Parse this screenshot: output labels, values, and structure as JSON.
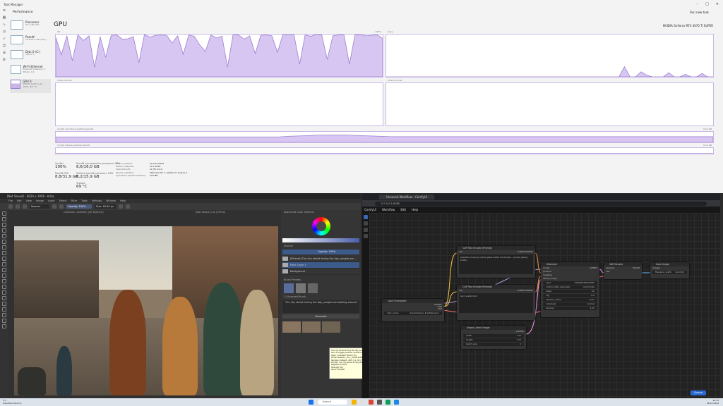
{
  "taskmanager": {
    "title": "Task Manager",
    "section": "Performance",
    "run_task": "Run new task",
    "sidebar": [
      {
        "name": "Processor",
        "sub": "4% 3.80 GHz"
      },
      {
        "name": "Paměť",
        "sub": "14,8/31,9 GB (46%)"
      },
      {
        "name": "Disk 0 (C:)",
        "sub": "SSD\n0 %"
      },
      {
        "name": "Wi-Fi Ethernet",
        "sub": "Ethernet\nOdesláno: 0 Přijato: 0 b"
      },
      {
        "name": "GPU 0",
        "sub": "NVIDIA GeForce R...\n100% (65 °C)"
      }
    ],
    "gpu_title": "GPU",
    "gpu_model": "NVIDIA GeForce RTX 4070 Ti SUPER",
    "panels": {
      "p3d": {
        "label": "3D",
        "right": "100%"
      },
      "copy": {
        "label": "Copy",
        "right": ""
      },
      "vdec": {
        "label": "Video Decode",
        "right": ""
      },
      "venc": {
        "label": "Video Encode",
        "right": ""
      },
      "dedicated": {
        "label": "Využití vyhrazené grafické paměti",
        "right": "16,0 GB"
      },
      "shared": {
        "label": "Využití sdílené grafické paměti",
        "right": "15,9 GB"
      }
    },
    "stats": {
      "util_label": "Využití",
      "util": "100%",
      "ded_label": "Paměť vyhrazeného procesoru GPU",
      "ded": "8,6/16,0 GB",
      "gpu_mem_label": "Paměť GPU",
      "gpu_mem": "8,8/31,9 GB",
      "shared_label": "Sdílená paměť procesoru GPU",
      "shared": "0,2/15,9 GB",
      "temp_label": "Teplota",
      "temp": "69 °C"
    },
    "details": {
      "labels": [
        "Verze ovladače:",
        "Datum ovladače:",
        "Verze DirectX:",
        "Fyzické umístění:",
        "Vyhrazená paměť hardwaru:"
      ],
      "values": [
        "32.0.15.6094",
        "10.7.2024",
        "12 (FL 12.1)",
        "Sběrnice PCI 1, zařízení 0, funkce 0",
        "123 MB"
      ]
    }
  },
  "krita": {
    "title": "[Not Saved]  - 4024 x 1956 - Krita",
    "menu": [
      "File",
      "Edit",
      "View",
      "Image",
      "Layer",
      "Select",
      "Filter",
      "Tools",
      "Settings",
      "Window",
      "Help"
    ],
    "preset": "Normal",
    "opacity": "Opacity: 100%",
    "size": "Size: 40.00 px",
    "tabs": [
      "Unknown (untitled) [2K 8-bit/ch]",
      "[Not Saved] 1.8 (1919x)"
    ],
    "docker_title": "Advanced Color Selector",
    "blend": "Normal",
    "opacity_row": "Opacity: 100%",
    "layers": [
      "[Filtered] The city street during the day, people are...",
      "Paint Layer 1",
      "Background"
    ],
    "brush_title": "Brush Presets",
    "brush_tag": "1) Unsaved Brush",
    "prompt_text": "The city street during the day, people are walking around",
    "generate": "Generate",
    "status_left": "Ahoj 1 Basic/Tangle",
    "status_mid": "RGB/Alpha (8-bit integer/channel)  sRGB-elle-V2-srgbtrc.icc",
    "status_right": "1,542.2 0.00 Mb",
    "zoom": "33.4%"
  },
  "tooltip": {
    "lines": [
      "The city street during the day, people are walking around",
      "Click to toggle preview, double-click to apply",
      "Style: Cinematic Photo (15)",
      "Model: Realistic_V5.1_noVAE.safetensors",
      "Sampler: Default - 60% 1.x (30 / 73)",
      "Prompt: The city street during the day, people are walking around",
      "Negative Prompt:",
      "Strength: 80",
      "Seed: 1234567"
    ]
  },
  "comfy": {
    "tab": "Unsaved Workflow - ComfyUI",
    "url": "127.0.0.1:8188",
    "menu": [
      "ComfyUI",
      "Workflow",
      "Edit",
      "Help"
    ],
    "queue": "Queue",
    "nodes": {
      "ckpt": {
        "title": "Load Checkpoint",
        "outs": [
          "MODEL",
          "CLIP",
          "VAE"
        ],
        "widget_label": "ckpt_name",
        "widget_value": "dreamshaper_8.safetensors"
      },
      "pos": {
        "title": "CLIP Text Encode (Prompt)",
        "out": "CONDITIONING",
        "in": "clip",
        "text": "beautiful scenery nature glass bottle landscape, , purple galaxy bottle,"
      },
      "neg": {
        "title": "CLIP Text Encode (Prompt)",
        "out": "CONDITIONING",
        "in": "clip",
        "text": "text, watermark"
      },
      "ks": {
        "title": "KSampler",
        "ins": [
          "model",
          "positive",
          "negative",
          "latent_image"
        ],
        "out": "LATENT",
        "widgets": [
          [
            "seed",
            "156680208700286"
          ],
          [
            "control_after_generate",
            "randomize"
          ],
          [
            "steps",
            "20"
          ],
          [
            "cfg",
            "8.0"
          ],
          [
            "sampler_name",
            "euler"
          ],
          [
            "scheduler",
            "normal"
          ],
          [
            "denoise",
            "1.00"
          ]
        ]
      },
      "latent": {
        "title": "Empty Latent Image",
        "out": "LATENT",
        "widgets": [
          [
            "width",
            "512"
          ],
          [
            "height",
            "512"
          ],
          [
            "batch_size",
            "1"
          ]
        ]
      },
      "vae": {
        "title": "VAE Decode",
        "ins": [
          "samples",
          "vae"
        ],
        "out": "IMAGE"
      },
      "save": {
        "title": "Save Image",
        "in": "images",
        "widget_label": "filename_prefix",
        "widget_value": "ComfyUI"
      }
    }
  },
  "taskbar": {
    "weather_temp": "5°C",
    "weather_text": "Převážně oblačno",
    "search": "Search",
    "time": "12:31",
    "date": "26.12.2024"
  },
  "chart_data": [
    {
      "type": "area",
      "title": "3D",
      "ylim": [
        0,
        100
      ],
      "values": [
        93,
        52,
        97,
        38,
        99,
        86,
        97,
        22,
        95,
        46,
        98,
        99,
        89,
        90,
        95,
        33,
        100,
        94,
        98,
        99,
        98,
        80,
        97,
        53,
        99,
        96,
        75,
        60,
        99,
        92,
        96,
        23,
        100,
        99,
        89,
        97,
        55,
        98,
        99,
        97,
        58,
        100,
        99,
        99,
        30,
        99,
        96,
        100,
        99,
        41,
        97,
        99,
        100,
        30,
        99,
        100,
        97,
        98,
        99,
        91
      ]
    },
    {
      "type": "area",
      "title": "Copy",
      "ylim": [
        0,
        100
      ],
      "values": [
        0,
        0,
        0,
        0,
        0,
        0,
        0,
        0,
        0,
        0,
        0,
        0,
        0,
        0,
        0,
        0,
        0,
        0,
        0,
        0,
        0,
        0,
        0,
        0,
        0,
        0,
        0,
        0,
        0,
        0,
        0,
        0,
        0,
        0,
        0,
        0,
        0,
        0,
        0,
        0,
        0,
        0,
        0,
        24,
        0,
        0,
        12,
        4,
        0,
        0,
        0,
        10,
        0,
        0,
        6,
        0,
        0,
        8,
        0,
        0
      ]
    },
    {
      "type": "area",
      "title": "Využití vyhrazené grafické paměti",
      "ylim": [
        0,
        100
      ],
      "values": [
        52,
        52,
        52,
        52,
        52,
        52,
        52,
        52,
        52,
        52,
        52,
        52,
        52,
        52,
        52,
        52,
        52,
        52,
        52,
        52,
        52,
        58,
        62,
        66,
        70,
        70,
        70,
        66,
        62,
        58,
        54,
        54,
        54,
        54,
        54,
        54,
        54,
        54,
        54,
        54,
        54,
        54,
        54,
        54,
        54,
        54,
        54,
        54,
        54,
        54,
        54,
        54,
        54,
        54,
        54,
        54,
        54,
        54,
        54,
        54
      ]
    },
    {
      "type": "area",
      "title": "Využití sdílené grafické paměti",
      "ylim": [
        0,
        100
      ],
      "values": [
        4,
        4,
        4,
        4,
        4,
        4,
        4,
        4,
        4,
        4,
        4,
        4,
        4,
        4,
        4,
        4,
        4,
        4,
        4,
        4,
        4,
        4,
        4,
        4,
        4,
        4,
        4,
        4,
        4,
        4,
        4,
        4,
        4,
        4,
        4,
        4,
        4,
        4,
        4,
        4,
        4,
        4,
        4,
        4,
        4,
        4,
        4,
        4,
        4,
        4,
        4,
        4,
        4,
        4,
        4,
        4,
        4,
        4,
        4,
        4
      ]
    }
  ]
}
